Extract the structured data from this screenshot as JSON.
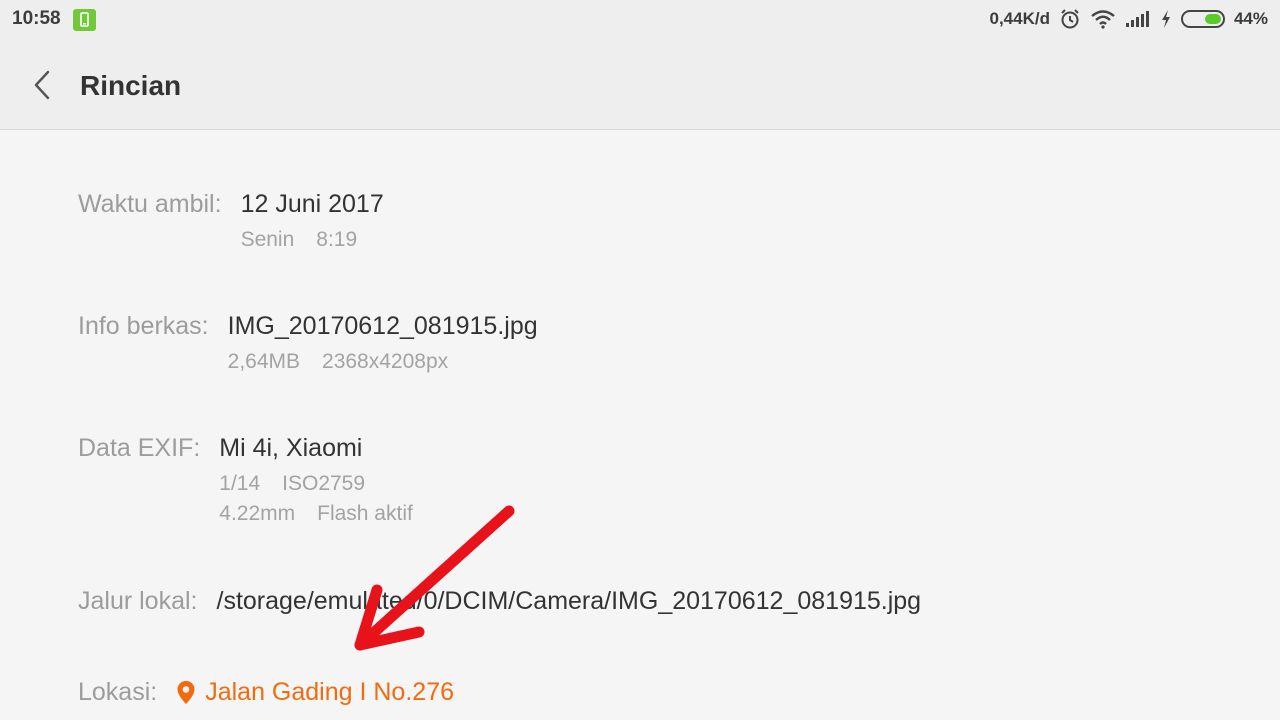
{
  "status_bar": {
    "time": "10:58",
    "net_speed": "0,44K/d",
    "battery_percent": "44%",
    "battery_level": 0.44,
    "icons": [
      "phone-icon",
      "alarm-icon",
      "wifi-icon",
      "signal-icon",
      "charging-icon",
      "battery-icon"
    ]
  },
  "header": {
    "title": "Rincian",
    "back_icon": "chevron-left-icon"
  },
  "details": {
    "taken": {
      "label": "Waktu ambil:",
      "date": "12 Juni 2017",
      "day": "Senin",
      "time": "8:19"
    },
    "file": {
      "label": "Info berkas:",
      "name": "IMG_20170612_081915.jpg",
      "size": "2,64MB",
      "resolution": "2368x4208px"
    },
    "exif": {
      "label": "Data EXIF:",
      "device": "Mi 4i, Xiaomi",
      "shutter": "1/14",
      "iso": "ISO2759",
      "focal": "4.22mm",
      "flash": "Flash aktif"
    },
    "path": {
      "label": "Jalur lokal:",
      "value": "/storage/emulated/0/DCIM/Camera/IMG_20170612_081915.jpg"
    },
    "location": {
      "label": "Lokasi:",
      "value": "Jalan Gading I No.276",
      "icon": "location-pin-icon"
    }
  },
  "colors": {
    "accent": "#f26b0f",
    "annotation_arrow": "#e8121b",
    "battery_fill": "#5ac92c"
  }
}
